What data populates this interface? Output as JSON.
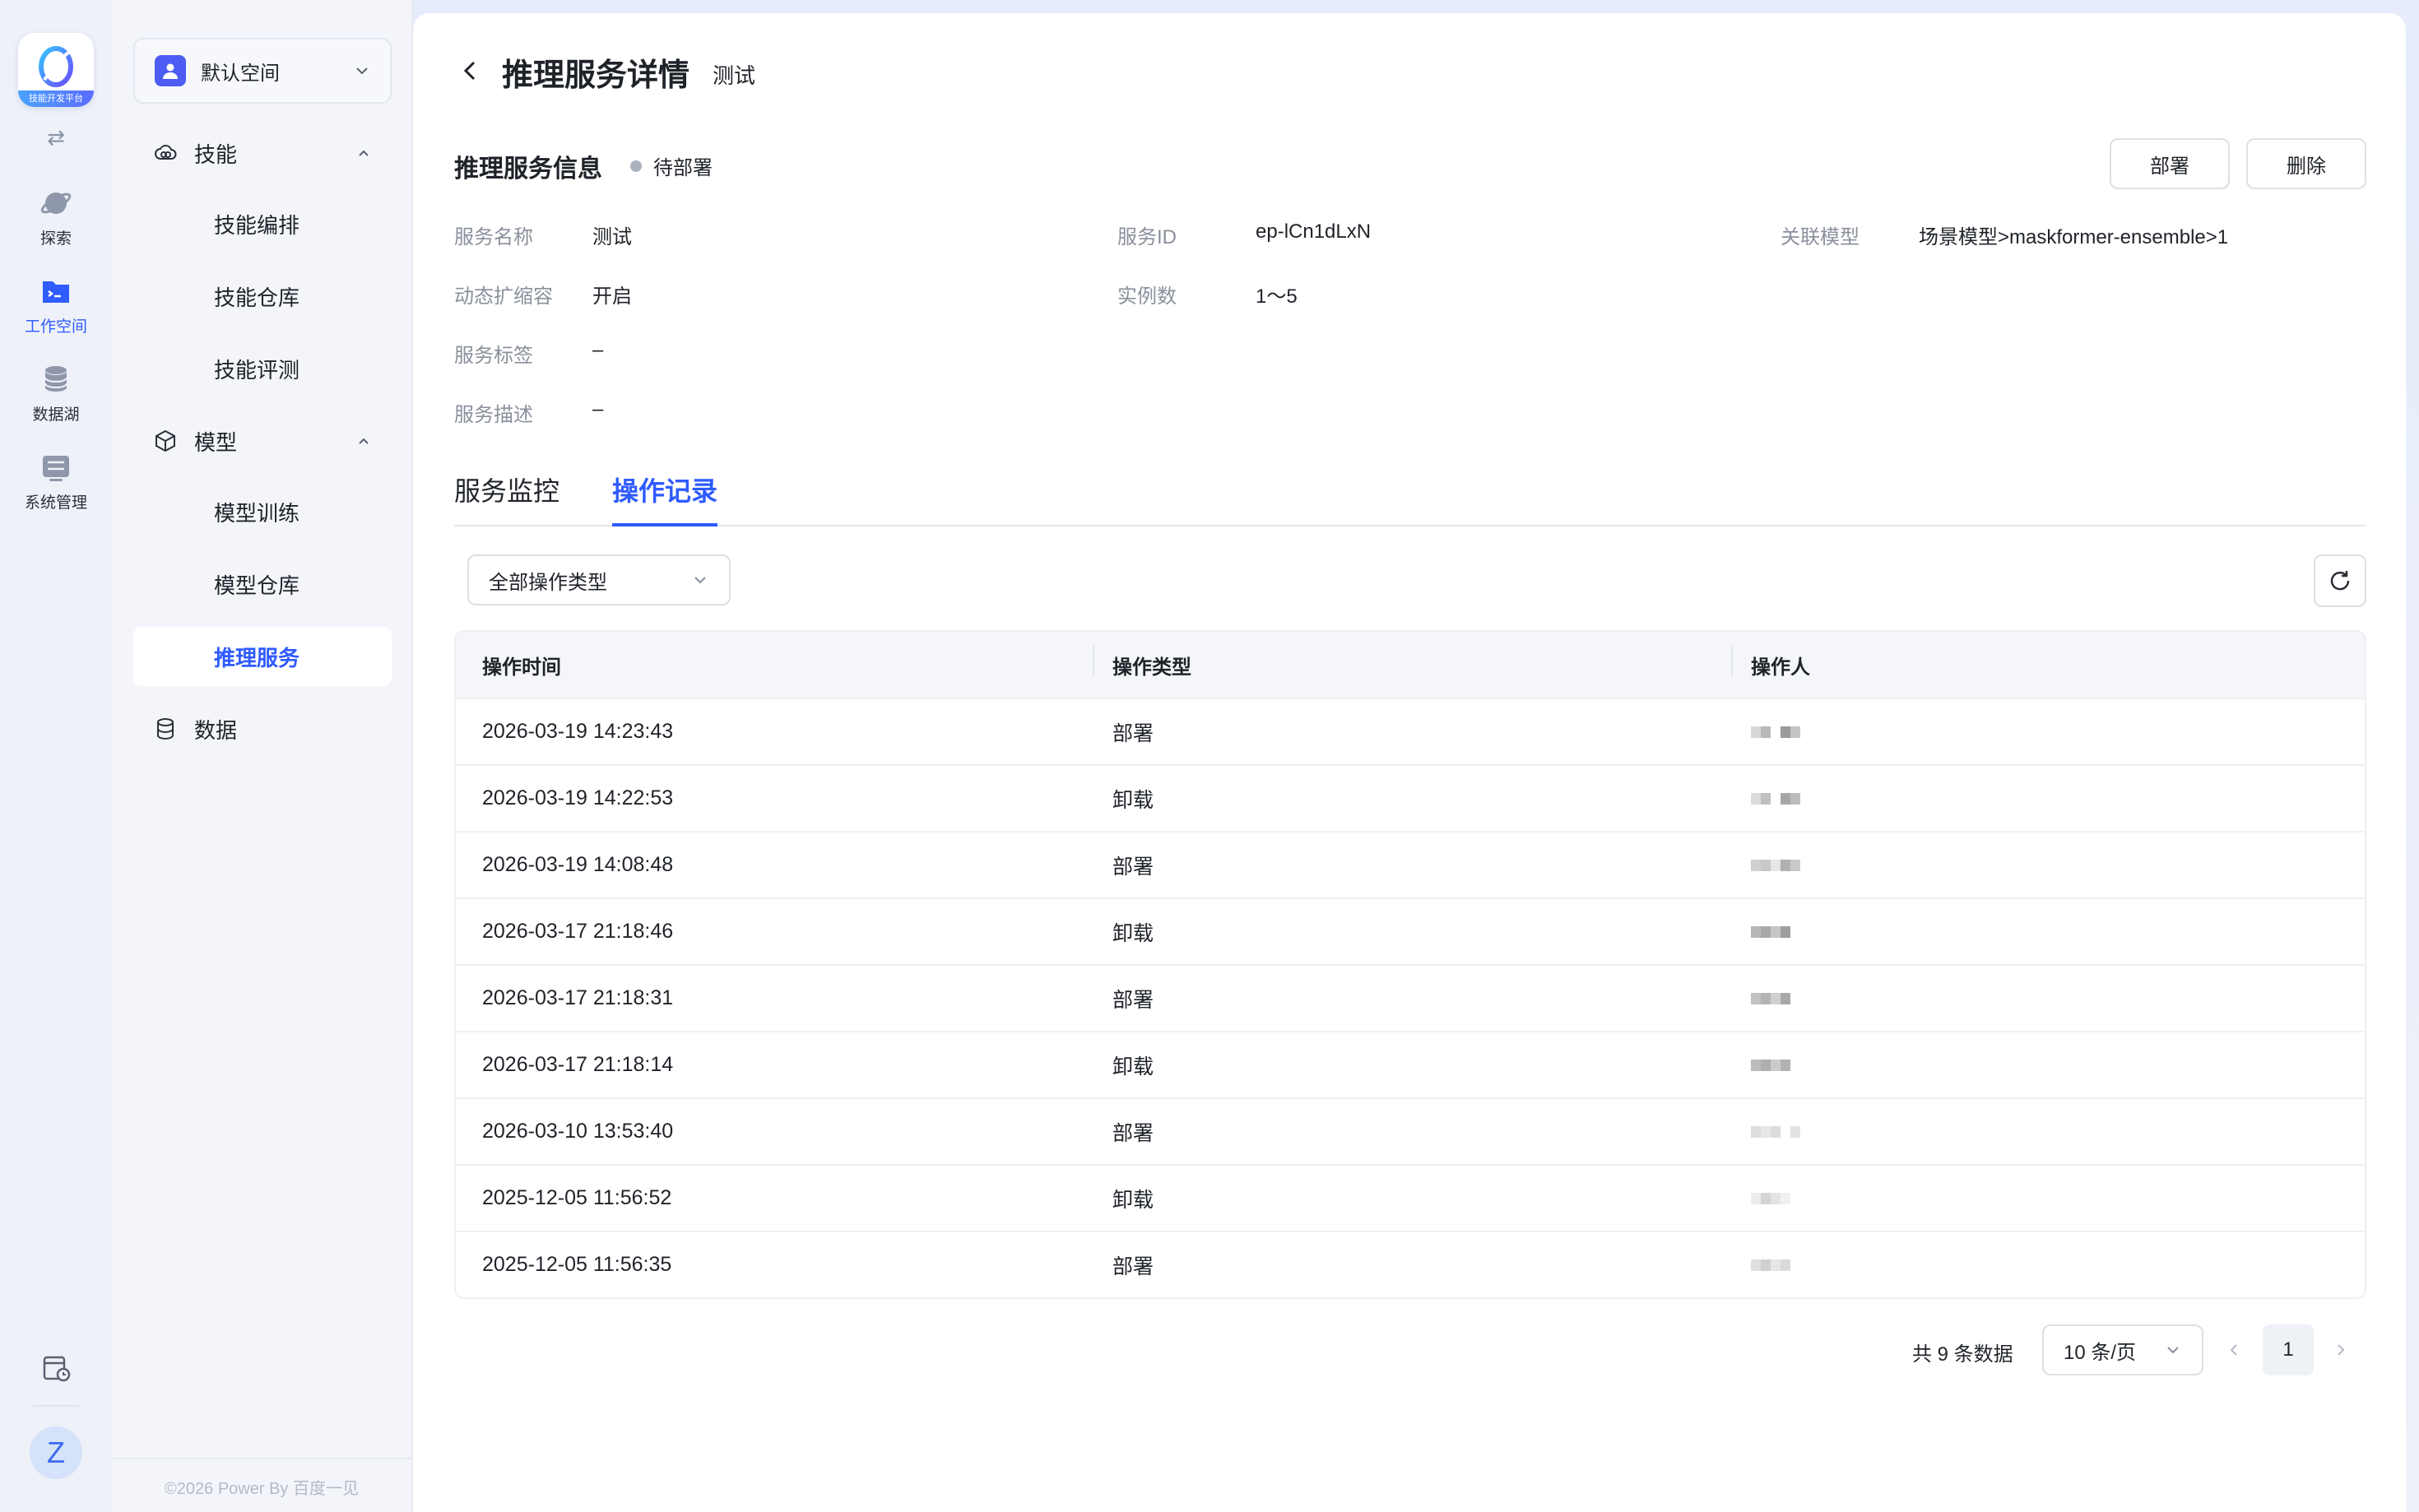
{
  "rail": {
    "logo_text": "技能开发平台",
    "items": [
      {
        "label": "探索",
        "icon": "planet-icon"
      },
      {
        "label": "工作空间",
        "icon": "folder-terminal-icon",
        "active": true
      },
      {
        "label": "数据湖",
        "icon": "database-icon"
      },
      {
        "label": "系统管理",
        "icon": "settings-panel-icon"
      }
    ],
    "avatar_initial": "Z"
  },
  "sidebar": {
    "space_label": "默认空间",
    "groups": [
      {
        "label": "技能",
        "items": [
          "技能编排",
          "技能仓库",
          "技能评测"
        ]
      },
      {
        "label": "模型",
        "items": [
          "模型训练",
          "模型仓库",
          "推理服务"
        ]
      },
      {
        "label": "数据",
        "items": []
      }
    ],
    "active_item": "推理服务",
    "copyright": "©2026 Power By 百度一见"
  },
  "header": {
    "title": "推理服务详情",
    "subtitle": "测试"
  },
  "info_section": {
    "title": "推理服务信息",
    "status": "待部署",
    "deploy_label": "部署",
    "delete_label": "删除",
    "fields": {
      "service_name": {
        "key": "服务名称",
        "value": "测试"
      },
      "service_id": {
        "key": "服务ID",
        "value": "ep-lCn1dLxN"
      },
      "linked_model": {
        "key": "关联模型",
        "value": "场景模型>maskformer-ensemble>1"
      },
      "autoscale": {
        "key": "动态扩缩容",
        "value": "开启"
      },
      "instances": {
        "key": "实例数",
        "value": "1～5"
      },
      "tags": {
        "key": "服务标签",
        "value": "–"
      },
      "description": {
        "key": "服务描述",
        "value": "–"
      }
    }
  },
  "tabs": [
    {
      "label": "服务监控",
      "active": false
    },
    {
      "label": "操作记录",
      "active": true
    }
  ],
  "filter": {
    "label": "全部操作类型"
  },
  "table": {
    "columns": [
      "操作时间",
      "操作类型",
      "操作人"
    ],
    "rows": [
      {
        "time": "2026-03-19 14:23:43",
        "type": "部署"
      },
      {
        "time": "2026-03-19 14:22:53",
        "type": "卸载"
      },
      {
        "time": "2026-03-19 14:08:48",
        "type": "部署"
      },
      {
        "time": "2026-03-17 21:18:46",
        "type": "卸载"
      },
      {
        "time": "2026-03-17 21:18:31",
        "type": "部署"
      },
      {
        "time": "2026-03-17 21:18:14",
        "type": "卸载"
      },
      {
        "time": "2026-03-10 13:53:40",
        "type": "部署"
      },
      {
        "time": "2025-12-05 11:56:52",
        "type": "卸载"
      },
      {
        "time": "2025-12-05 11:56:35",
        "type": "部署"
      }
    ]
  },
  "pagination": {
    "total_text": "共 9 条数据",
    "page_size": "10 条/页",
    "current_page": "1"
  },
  "colors": {
    "accent": "#2f5bff",
    "status_pending": "#aab2c0"
  }
}
